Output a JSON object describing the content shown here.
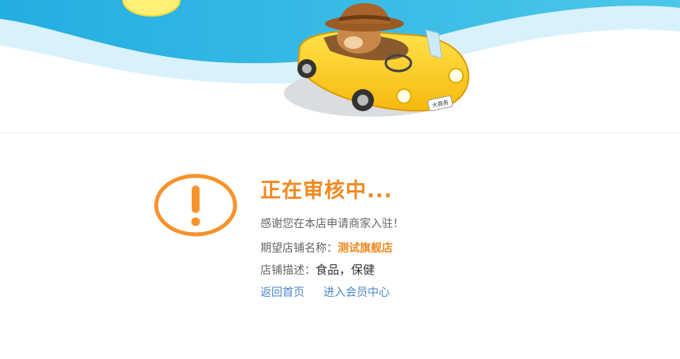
{
  "colors": {
    "accent": "#f08a22",
    "link": "#4a86c7",
    "sky": "#2fb6e3",
    "text": "#666666"
  },
  "banner": {
    "icons": [
      "sun-icon",
      "mascot-car-illustration"
    ],
    "plate_text": "大商务"
  },
  "status": {
    "icon": "exclamation-circle-icon",
    "title": "正在审核中...",
    "thanks": "感谢您在本店申请商家入驻！",
    "store_name_label": "期望店铺名称：",
    "store_name_value": "测试旗舰店",
    "store_desc_label": "店铺描述：",
    "store_desc_value": "食品，保健"
  },
  "links": {
    "home": "返回首页",
    "member_center": "进入会员中心"
  }
}
